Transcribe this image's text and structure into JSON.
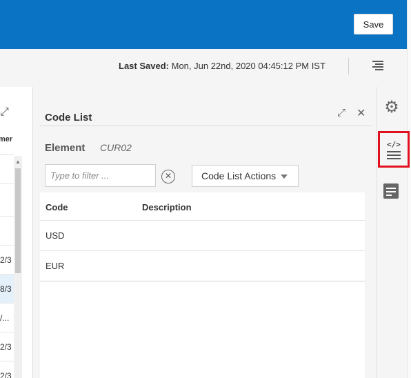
{
  "header": {
    "save_label": "Save",
    "last_saved_label": "Last Saved:",
    "last_saved_value": "Mon, Jun 22nd, 2020 04:45:12 PM IST"
  },
  "left_grid": {
    "column_fragment": "mer",
    "row_fragments": [
      "",
      "",
      "",
      "2/3",
      "8/3",
      "/...",
      "2/3",
      "2/3"
    ]
  },
  "code_list_panel": {
    "title": "Code List",
    "element_label": "Element",
    "element_value": "CUR02",
    "filter_placeholder": "Type to filter ...",
    "actions_label": "Code List Actions",
    "columns": {
      "code": "Code",
      "description": "Description"
    },
    "rows": [
      {
        "code": "USD",
        "description": ""
      },
      {
        "code": "EUR",
        "description": ""
      }
    ]
  },
  "right_rail": {
    "items": [
      "gear-icon",
      "code-list-icon",
      "notes-icon"
    ],
    "highlight_color": "#e0101e"
  },
  "colors": {
    "topbar": "#0b73c4"
  }
}
